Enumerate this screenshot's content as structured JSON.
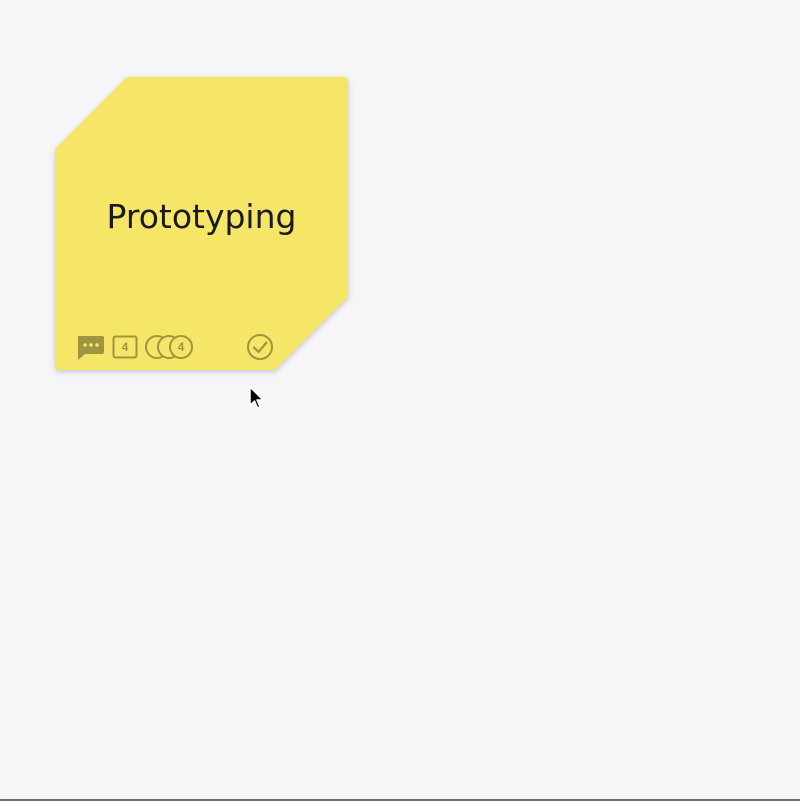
{
  "sticky_note": {
    "title": "Prototyping",
    "color": "#f6e668",
    "icons": {
      "comments": "comment-icon",
      "tasks": "tasks-icon",
      "assignees": "assignees-icon",
      "done": "check-circle-icon"
    },
    "task_count": "4",
    "assignee_count": "4"
  },
  "colors": {
    "background": "#f6f5f8",
    "icon": "#9f9440"
  }
}
